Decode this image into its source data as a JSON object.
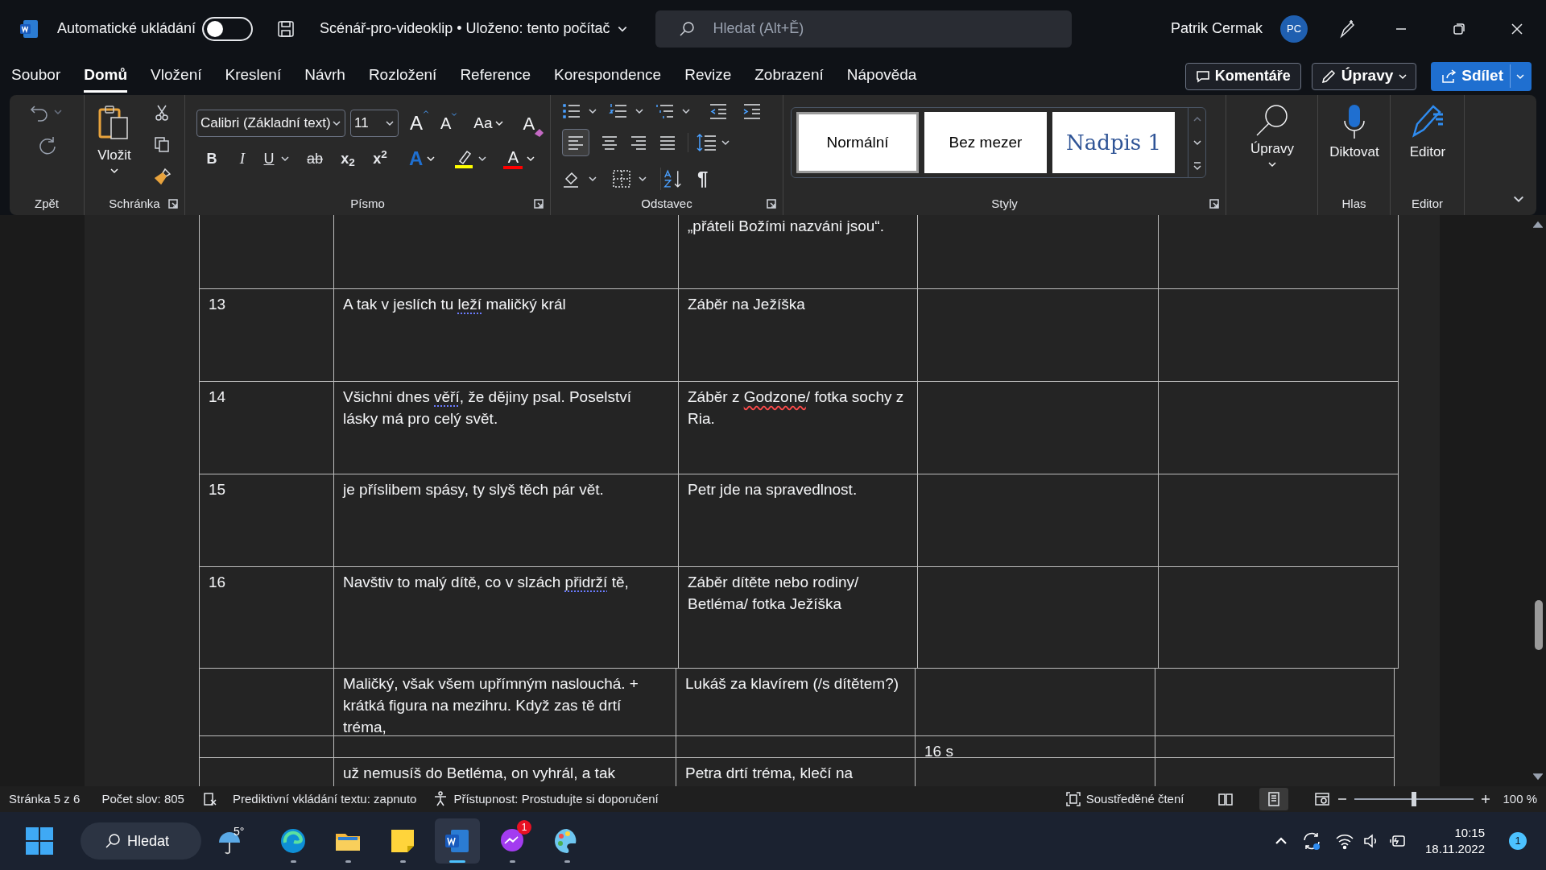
{
  "title_bar": {
    "autosave_label": "Automatické ukládání",
    "autosave_on": false,
    "document_title": "Scénář-pro-videoklip • Uloženo: tento počítač",
    "search_placeholder": "Hledat (Alt+Ě)",
    "user_name": "Patrik Cermak",
    "user_initials": "PC"
  },
  "menu_tabs": [
    {
      "label": "Soubor",
      "selected": false
    },
    {
      "label": "Domů",
      "selected": true
    },
    {
      "label": "Vložení",
      "selected": false
    },
    {
      "label": "Kreslení",
      "selected": false
    },
    {
      "label": "Návrh",
      "selected": false
    },
    {
      "label": "Rozložení",
      "selected": false
    },
    {
      "label": "Reference",
      "selected": false
    },
    {
      "label": "Korespondence",
      "selected": false
    },
    {
      "label": "Revize",
      "selected": false
    },
    {
      "label": "Zobrazení",
      "selected": false
    },
    {
      "label": "Nápověda",
      "selected": false
    }
  ],
  "actions": {
    "comments": "Komentáře",
    "editing": "Úpravy",
    "share": "Sdílet"
  },
  "ribbon": {
    "undo_label": "Zpět",
    "clipboard": {
      "label": "Schránka",
      "paste": "Vložit"
    },
    "font": {
      "label": "Písmo",
      "family": "Calibri (Základní text)",
      "size": "11",
      "grow": "A",
      "shrink": "A",
      "change_case": "Aa",
      "clear": "A",
      "formats": [
        {
          "text": "B",
          "kind": "bold"
        },
        {
          "text": "I",
          "kind": "italic"
        },
        {
          "text": "U",
          "kind": "underline"
        },
        {
          "text": "ab",
          "kind": "strike"
        },
        {
          "text": "x$_{2}$",
          "kind": "sub"
        },
        {
          "text": "x$^{2}$",
          "kind": "super"
        }
      ],
      "effects": "A",
      "font_color": "A"
    },
    "paragraph": {
      "label": "Odstavec",
      "pilcrow": "¶"
    },
    "styles": {
      "label": "Styly",
      "items": [
        {
          "label": "Normální",
          "selected": true,
          "kind": "normal"
        },
        {
          "label": "Bez mezer",
          "selected": false,
          "kind": "normal"
        },
        {
          "label": "Nadpis 1",
          "selected": false,
          "kind": "heading"
        }
      ]
    },
    "editing": {
      "label": "Úpravy"
    },
    "voice": {
      "label": "Hlas",
      "button": "Diktovat"
    },
    "editor": {
      "label": "Editor",
      "button": "Editor"
    }
  },
  "table": {
    "rows": [
      {
        "cells": [
          [],
          [],
          [
            {
              "text": "„přáteli Božími nazváni jsou“."
            }
          ],
          [],
          []
        ]
      },
      {
        "cells": [
          [
            {
              "text": "13"
            }
          ],
          [
            {
              "text": "A tak v jeslích tu "
            },
            {
              "text": "leží",
              "grammar_flag": true
            },
            {
              "text": " maličký král"
            }
          ],
          [
            {
              "text": "Záběr na Ježíška"
            }
          ],
          [],
          []
        ]
      },
      {
        "cells": [
          [
            {
              "text": "14"
            }
          ],
          [
            {
              "text": "Všichni dnes "
            },
            {
              "text": "věří",
              "grammar_flag": true
            },
            {
              "text": ", že dějiny psal. Poselství lásky má pro celý svět."
            }
          ],
          [
            {
              "text": "Záběr z "
            },
            {
              "text": "Godzone",
              "spelling_flag": true
            },
            {
              "text": "/ fotka sochy z Ria."
            }
          ],
          [],
          []
        ]
      },
      {
        "cells": [
          [
            {
              "text": "15"
            }
          ],
          [
            {
              "text": "je příslibem spásy, ty slyš těch pár vět."
            }
          ],
          [
            {
              "text": "Petr jde na spravedlnost."
            }
          ],
          [],
          []
        ]
      },
      {
        "cells": [
          [
            {
              "text": "16"
            }
          ],
          [
            {
              "text": "Navštiv to malý dítě, co v slzách "
            },
            {
              "text": "přidrží",
              "grammar_flag": true
            },
            {
              "text": " tě,"
            }
          ],
          [
            {
              "text": "Záběr dítěte nebo rodiny/ Betléma/ fotka Ježíška"
            }
          ],
          [],
          []
        ]
      }
    ]
  },
  "table_2": {
    "rows": [
      {
        "cells": [
          [],
          [
            {
              "text": "Maličký, však všem upřímným naslouchá. + krátká figura na mezihru. Když zas tě drtí tréma,"
            }
          ],
          [
            {
              "text": "Lukáš za klavírem (/s dítětem?)"
            }
          ],
          [],
          []
        ]
      },
      {
        "cells": [
          [],
          [],
          [],
          [
            {
              "text": "16 s"
            }
          ],
          []
        ]
      },
      {
        "cells": [
          [],
          [
            {
              "text": "už nemusíš do Betléma, on vyhrál, a tak"
            }
          ],
          [
            {
              "text": "Petra drtí tréma, klečí na"
            }
          ],
          [],
          []
        ]
      }
    ]
  },
  "status_bar": {
    "page": "Stránka 5 z 6",
    "words": "Počet slov: 805",
    "predictive": "Prediktivní vkládání textu: zapnuto",
    "accessibility": "Přístupnost: Prostudujte si doporučení",
    "focus": "Soustředěné čtení",
    "views": [
      {
        "kind": "read",
        "selected": false
      },
      {
        "kind": "print",
        "selected": true
      },
      {
        "kind": "web",
        "selected": false
      }
    ],
    "zoom_slider": {
      "level": 0.5
    },
    "zoom": "100 %"
  },
  "taskbar": {
    "search": "Hledat",
    "weather": "5°",
    "apps": [
      {
        "kind": "edge",
        "active": false,
        "running": true
      },
      {
        "kind": "explorer",
        "active": false,
        "running": true
      },
      {
        "kind": "notes",
        "active": false,
        "running": true
      },
      {
        "kind": "word",
        "active": true,
        "running": true
      },
      {
        "kind": "messenger",
        "active": false,
        "running": true,
        "badge": "1"
      },
      {
        "kind": "paint",
        "active": false,
        "running": true
      }
    ],
    "time": "10:15",
    "date": "18.11.2022",
    "notifications": "1"
  }
}
